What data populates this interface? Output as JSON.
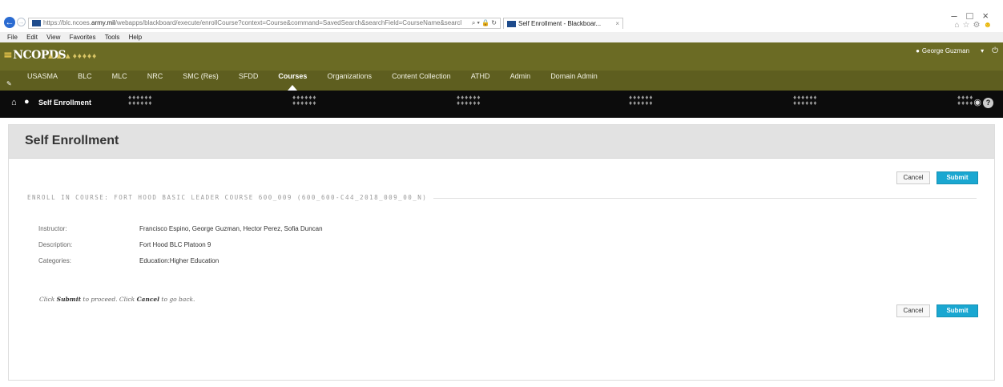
{
  "browser": {
    "address_prefix": "https://blc.ncoes.",
    "address_host": "army.mil",
    "address_rest": "/webapps/blackboard/execute/enrollCourse?context=Course&command=SavedSearch&searchField=CourseName&searcl",
    "address_tools": "⌕ ▾ 🔒 ↻",
    "tab_title": "Self Enrollment - Blackboar...",
    "menu": [
      "File",
      "Edit",
      "View",
      "Favorites",
      "Tools",
      "Help"
    ]
  },
  "header": {
    "logo": "NCOPDS",
    "user_name": "George Guzman"
  },
  "nav": {
    "items": [
      {
        "label": "USASMA",
        "active": false
      },
      {
        "label": "BLC",
        "active": false
      },
      {
        "label": "MLC",
        "active": false
      },
      {
        "label": "NRC",
        "active": false
      },
      {
        "label": "SMC (Res)",
        "active": false
      },
      {
        "label": "SFDD",
        "active": false
      },
      {
        "label": "Courses",
        "active": true
      },
      {
        "label": "Organizations",
        "active": false
      },
      {
        "label": "Content Collection",
        "active": false
      },
      {
        "label": "ATHD",
        "active": false
      },
      {
        "label": "Admin",
        "active": false
      },
      {
        "label": "Domain Admin",
        "active": false
      }
    ]
  },
  "breadcrumb": {
    "label": "Self Enrollment"
  },
  "page": {
    "title": "Self Enrollment",
    "cancel_label": "Cancel",
    "submit_label": "Submit",
    "section_heading": "ENROLL IN COURSE: FORT HOOD BASIC LEADER COURSE 600_009 (600_600-C44_2018_009_00_N)",
    "details": [
      {
        "label": "Instructor:",
        "value": "Francisco Espino, George Guzman, Hector Perez, Sofia Duncan"
      },
      {
        "label": "Description:",
        "value": "Fort Hood BLC Platoon 9"
      },
      {
        "label": "Categories:",
        "value": "Education:Higher Education"
      }
    ],
    "hint_prefix": "Click ",
    "hint_submit": "Submit",
    "hint_middle": " to proceed. Click ",
    "hint_cancel": "Cancel",
    "hint_suffix": " to go back."
  },
  "colors": {
    "brand_olive": "#6b6b24",
    "nav_olive": "#5e5e1f",
    "breadcrumb_black": "#0c0c0c",
    "submit_blue": "#1aa7d1"
  }
}
